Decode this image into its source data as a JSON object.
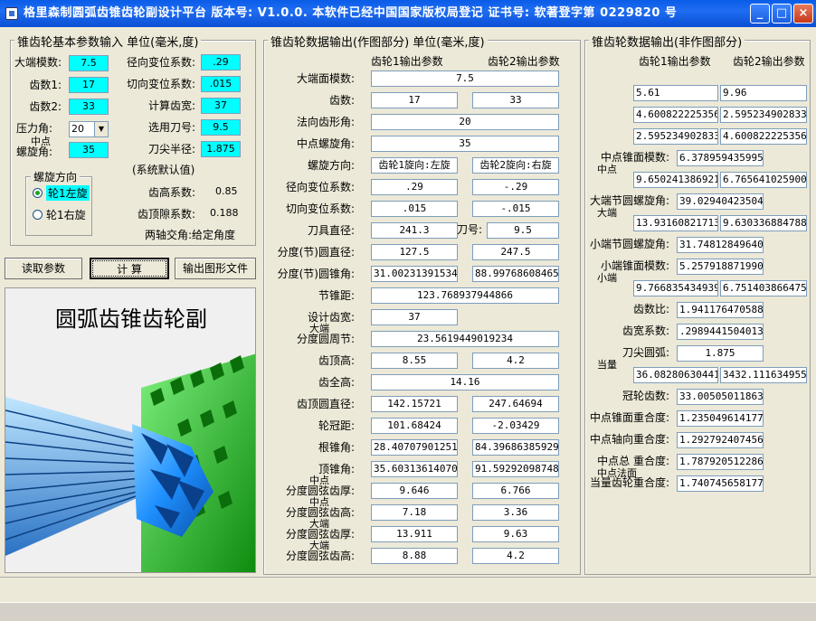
{
  "window": {
    "title": "格里森制圆弧齿锥齿轮副设计平台 版本号: V1.0.0. 本软件已经中国国家版权局登记 证书号: 软著登字第 0229820 号",
    "minimize": "_",
    "maximize": "□",
    "close": "×"
  },
  "input_panel": {
    "title": "锥齿轮基本参数输入 单位(毫米,度)",
    "big_module_label": "大端模数:",
    "big_module_value": "7.5",
    "teeth1_label": "齿数1:",
    "teeth1_value": "17",
    "teeth2_label": "齿数2:",
    "teeth2_value": "33",
    "pressure_angle_label": "压力角:",
    "pressure_angle_value": "20",
    "mid_label_top": "中点",
    "spiral_angle_label": "螺旋角:",
    "spiral_angle_value": "35",
    "radial_shift_label": "径向变位系数:",
    "radial_shift_value": ".29",
    "tangential_shift_label": "切向变位系数:",
    "tangential_shift_value": ".015",
    "calc_face_label": "计算齿宽:",
    "calc_face_value": "37",
    "cutter_no_label": "选用刀号:",
    "cutter_no_value": "9.5",
    "tip_radius_label": "刀尖半径:",
    "tip_radius_value": "1.875",
    "default_note": "(系统默认值)",
    "addendum_coef_label": "齿高系数:",
    "addendum_coef_value": "0.85",
    "clearance_coef_label": "齿顶隙系数:",
    "clearance_coef_value": "0.188",
    "shaft_angle_label": "两轴交角:给定角度",
    "hand_group_title": "螺旋方向",
    "hand_left": "轮1左旋",
    "hand_right": "轮1右旋"
  },
  "buttons": {
    "read": "读取参数",
    "calc": "计  算",
    "export": "输出图形文件"
  },
  "preview": {
    "title": "圆弧齿锥齿轮副"
  },
  "mid_panel": {
    "title": "锥齿轮数据输出(作图部分) 单位(毫米,度)",
    "col1": "齿轮1输出参数",
    "col2": "齿轮2输出参数",
    "rows": [
      {
        "label": "大端面模数:",
        "v1": "7.5",
        "v2": "",
        "span": true
      },
      {
        "label": "齿数:",
        "v1": "17",
        "v2": "33"
      },
      {
        "label": "法向齿形角:",
        "v1": "20",
        "v2": "",
        "span": true
      },
      {
        "label": "中点螺旋角:",
        "v1": "35",
        "v2": "",
        "span": true
      },
      {
        "label": "螺旋方向:",
        "v1": "齿轮1旋向:左旋",
        "v2": "齿轮2旋向:右旋"
      },
      {
        "label": "径向变位系数:",
        "v1": ".29",
        "v2": "-.29"
      },
      {
        "label": "切向变位系数:",
        "v1": ".015",
        "v2": "-.015"
      },
      {
        "label": "刀具直径:",
        "v1": "241.3",
        "v2": "9.5",
        "mid": "刀号:"
      },
      {
        "label": "分度(节)圆直径:",
        "v1": "127.5",
        "v2": "247.5"
      },
      {
        "label": "分度(节)圆锥角:",
        "v1": "31.002313915345",
        "v2": "88.997686084654"
      },
      {
        "label": "节锥距:",
        "v1": "123.768937944866",
        "v2": "",
        "span": true
      },
      {
        "label": "设计齿宽:",
        "v1": "37",
        "v2": "",
        "span": true,
        "short": true
      },
      {
        "label": "分度圆周节:",
        "top": "大端",
        "v1": "23.5619449019234",
        "v2": "",
        "span": true
      },
      {
        "label": "齿顶高:",
        "v1": "8.55",
        "v2": "4.2"
      },
      {
        "label": "齿全高:",
        "v1": "14.16",
        "v2": "",
        "span": true
      },
      {
        "label": "齿顶圆直径:",
        "v1": "142.15721",
        "v2": "247.64694"
      },
      {
        "label": "轮冠距:",
        "v1": "101.68424",
        "v2": "-2.03429"
      },
      {
        "label": "根锥角:",
        "v1": "28.407079012512",
        "v2": "84.396863859298"
      },
      {
        "label": "顶锥角:",
        "v1": "35.603136140701",
        "v2": "91.592920987487"
      },
      {
        "label": "分度圆弦齿厚:",
        "top": "中点",
        "v1": "9.646",
        "v2": "6.766"
      },
      {
        "label": "分度圆弦齿高:",
        "top": "中点",
        "v1": "7.18",
        "v2": "3.36"
      },
      {
        "label": "分度圆弦齿厚:",
        "top": "大端",
        "v1": "13.911",
        "v2": "9.63"
      },
      {
        "label": "分度圆弦齿高:",
        "top": "大端",
        "v1": "8.88",
        "v2": "4.2"
      }
    ]
  },
  "right_panel": {
    "title": "锥齿轮数据输出(非作图部分)",
    "col1": "齿轮1输出参数",
    "col2": "齿轮2输出参数",
    "rows": [
      {
        "label": "齿根高:",
        "v1": "5.61",
        "v2": "9.96"
      },
      {
        "label": "齿顶角:",
        "v1": "4.6008222253560",
        "v2": "2.5952349028333"
      },
      {
        "label": "齿根角:",
        "v1": "2.5952349028333",
        "v2": "4.6008222253560"
      },
      {
        "label": "中点锥面模数:",
        "v1": "6.3789594359951",
        "v2": ""
      },
      {
        "label": "弧齿厚:",
        "top": "中点",
        "v1": "9.6502413869214",
        "v2": "6.7656410259008"
      },
      {
        "label": "大端节圆螺旋角:",
        "v1": "39.029404235049",
        "v2": ""
      },
      {
        "label": "弧齿厚:",
        "top": "大端",
        "v1": "13.931608217135",
        "v2": "9.6303368847884"
      },
      {
        "label": "小端节圆螺旋角:",
        "v1": "31.748128496407",
        "v2": ""
      },
      {
        "label": "小端锥面模数:",
        "v1": "5.2579188719901",
        "v2": ""
      },
      {
        "label": "弧齿厚:",
        "top": "小端",
        "v1": "9.7668354349396",
        "v2": "6.7514038664758"
      },
      {
        "label": "齿数比:",
        "v1": "1.9411764705882",
        "v2": ""
      },
      {
        "label": "齿宽系数:",
        "v1": ".29894415040130",
        "v2": ""
      },
      {
        "label": "刀尖圆弧:",
        "v1": "1.875",
        "v2": "",
        "center": true
      },
      {
        "label": "齿数:",
        "top": "当量",
        "v1": "36.082806304417",
        "v2": "3432.1116349550"
      },
      {
        "label": "冠轮齿数:",
        "v1": "33.005050118630",
        "v2": ""
      },
      {
        "label": "中点锥面重合度:",
        "v1": "1.2350496141770",
        "v2": ""
      },
      {
        "label": "中点轴向重合度:",
        "v1": "1.2927924074561",
        "v2": ""
      },
      {
        "label": "中点总 重合度:",
        "v1": "1.7879205122865",
        "v2": ""
      },
      {
        "label": "当量齿轮重合度:",
        "top": "中点法面",
        "v1": "1.7407456581774",
        "v2": ""
      }
    ]
  },
  "colors": {
    "titlebar": "#0a5ce8",
    "highlight_input": "#00ffff",
    "gear_blue": "#1e90ff",
    "gear_green": "#22c522"
  }
}
